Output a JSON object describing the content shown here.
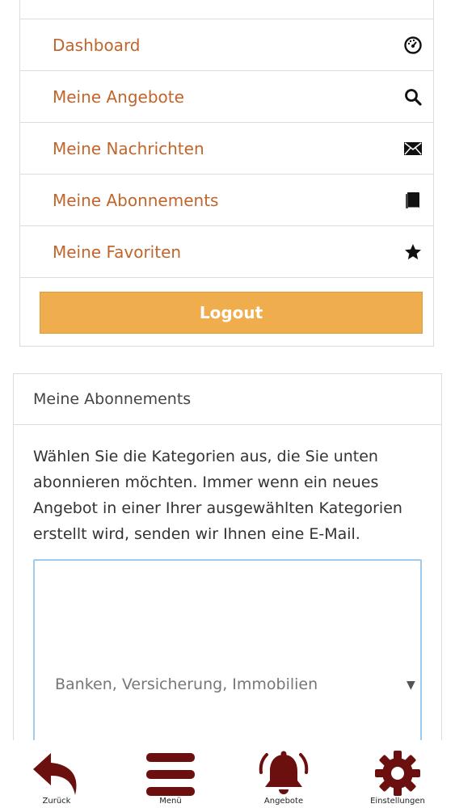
{
  "nav": {
    "items": [
      {
        "label": "Dashboard",
        "icon": "dashboard-icon"
      },
      {
        "label": "Meine Angebote",
        "icon": "search-icon"
      },
      {
        "label": "Meine Nachrichten",
        "icon": "envelope-icon"
      },
      {
        "label": "Meine Abonnements",
        "icon": "book-icon"
      },
      {
        "label": "Meine Favoriten",
        "icon": "star-icon"
      }
    ],
    "logout_label": "Logout"
  },
  "subscriptions": {
    "title": "Meine Abonnements",
    "description": "Wählen Sie die Kategorien aus, die Sie unten abonnieren möchten. Immer wenn ein neues Angebot in einer Ihrer ausgewählten Kategorien erstellt wird, senden wir Ihnen eine E-Mail.",
    "selected_category": "Banken, Versicherung, Immobilien"
  },
  "tabbar": {
    "items": [
      {
        "label": "Zurück",
        "icon": "back-arrow-icon"
      },
      {
        "label": "Menü",
        "icon": "hamburger-menu-icon"
      },
      {
        "label": "Angebote",
        "icon": "bell-icon"
      },
      {
        "label": "Einstellungen",
        "icon": "gear-icon"
      }
    ]
  },
  "colors": {
    "link": "#c0652b",
    "logout_bg": "#f0ad4e",
    "tab_icon": "#6b0f0f",
    "select_border": "#9ecaed"
  }
}
